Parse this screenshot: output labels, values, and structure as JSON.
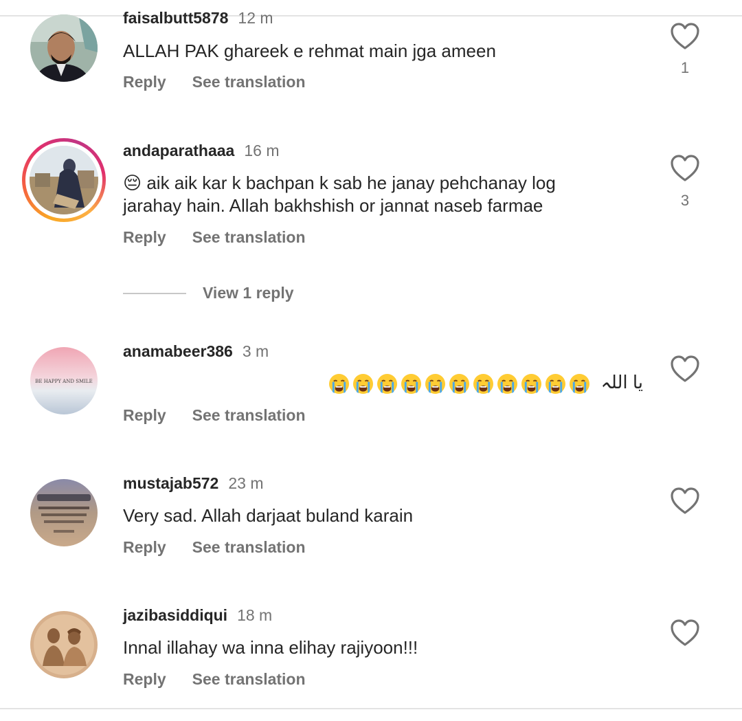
{
  "comments": [
    {
      "username": "faisalbutt5878",
      "time": "12 m",
      "text": "ALLAH PAK ghareek e rehmat main jga ameen",
      "likes": "1",
      "reply_label": "Reply",
      "translate_label": "See translation"
    },
    {
      "username": "andaparathaaa",
      "time": "16 m",
      "text_line1": "aik aik kar k bachpan k sab he janay pehchanay log",
      "text_line2": "jarahay hain. Allah bakhshish or jannat naseb farmae",
      "emoji": "😔",
      "likes": "3",
      "reply_label": "Reply",
      "translate_label": "See translation",
      "view_replies": "View 1 reply"
    },
    {
      "username": "anamabeer386",
      "time": "3 m",
      "text": "یا اللہ",
      "emoji_count": 11,
      "avatar_text": "BE HAPPY AND SMILE",
      "reply_label": "Reply",
      "translate_label": "See translation"
    },
    {
      "username": "mustajab572",
      "time": "23 m",
      "text": "Very sad. Allah darjaat buland karain",
      "reply_label": "Reply",
      "translate_label": "See translation"
    },
    {
      "username": "jazibasiddiqui",
      "time": "18 m",
      "text": "Innal illahay wa inna elihay rajiyoon!!!",
      "reply_label": "Reply",
      "translate_label": "See translation"
    }
  ],
  "colors": {
    "primary_text": "#262626",
    "secondary_text": "#737373",
    "divider": "#e3e3e3"
  },
  "icons": [
    "heart-outline-icon",
    "crying-face-emoji",
    "pensive-face-emoji"
  ]
}
